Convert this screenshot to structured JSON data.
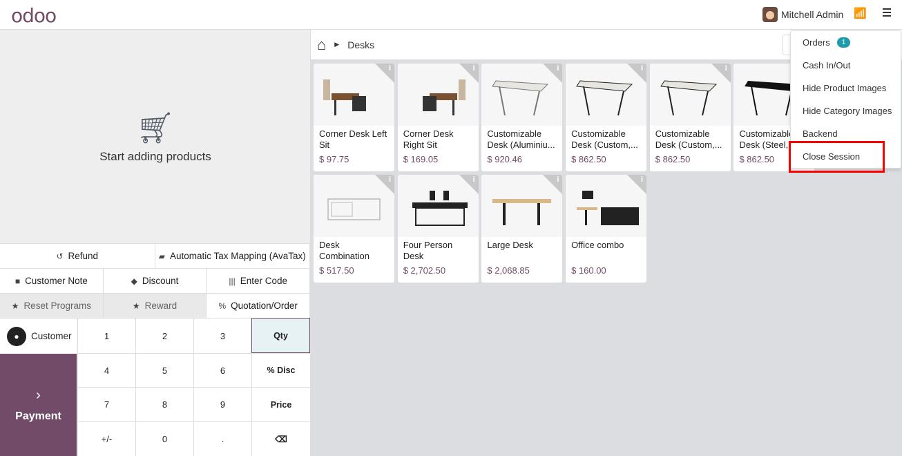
{
  "header": {
    "logo": "odoo",
    "user": "Mitchell Admin",
    "icons": [
      "avatar",
      "wifi-icon",
      "menu-icon"
    ]
  },
  "order": {
    "empty_text": "Start adding products"
  },
  "controls": {
    "row1": [
      "Refund",
      "Automatic Tax Mapping (AvaTax)"
    ],
    "row2": [
      "Customer Note",
      "Discount",
      "Enter Code"
    ],
    "row3": [
      "Reset Programs",
      "Reward",
      "Quotation/Order"
    ]
  },
  "numpad": {
    "customer": "Customer",
    "payment": "Payment",
    "keys": [
      "1",
      "2",
      "3",
      "Qty",
      "4",
      "5",
      "6",
      "% Disc",
      "7",
      "8",
      "9",
      "Price",
      "+/-",
      "0",
      ".",
      "⌫"
    ],
    "active": "Qty"
  },
  "breadcrumb": {
    "category": "Desks"
  },
  "products": [
    {
      "name": "Corner Desk Left Sit",
      "price": "$ 97.75"
    },
    {
      "name": "Corner Desk Right Sit",
      "price": "$ 169.05"
    },
    {
      "name": "Customizable Desk (Aluminiu...",
      "price": "$ 920.46"
    },
    {
      "name": "Customizable Desk (Custom,...",
      "price": "$ 862.50"
    },
    {
      "name": "Customizable Desk (Custom,...",
      "price": "$ 862.50"
    },
    {
      "name": "Customizable Desk (Steel,...",
      "price": "$ 862.50"
    },
    {
      "name": "Desk Combination",
      "price": "$ 517.50"
    },
    {
      "name": "Four Person Desk",
      "price": "$ 2,702.50"
    },
    {
      "name": "Large Desk",
      "price": "$ 2,068.85"
    },
    {
      "name": "Office combo",
      "price": "$ 160.00"
    }
  ],
  "menu": {
    "items": [
      "Orders",
      "Cash In/Out",
      "Hide Product Images",
      "Hide Category Images",
      "Backend",
      "Close Session"
    ],
    "orders_badge": "1",
    "highlighted": "Close Session"
  },
  "colors": {
    "brand": "#714B67",
    "badge": "#1e9aab",
    "highlight": "#ff0000"
  }
}
